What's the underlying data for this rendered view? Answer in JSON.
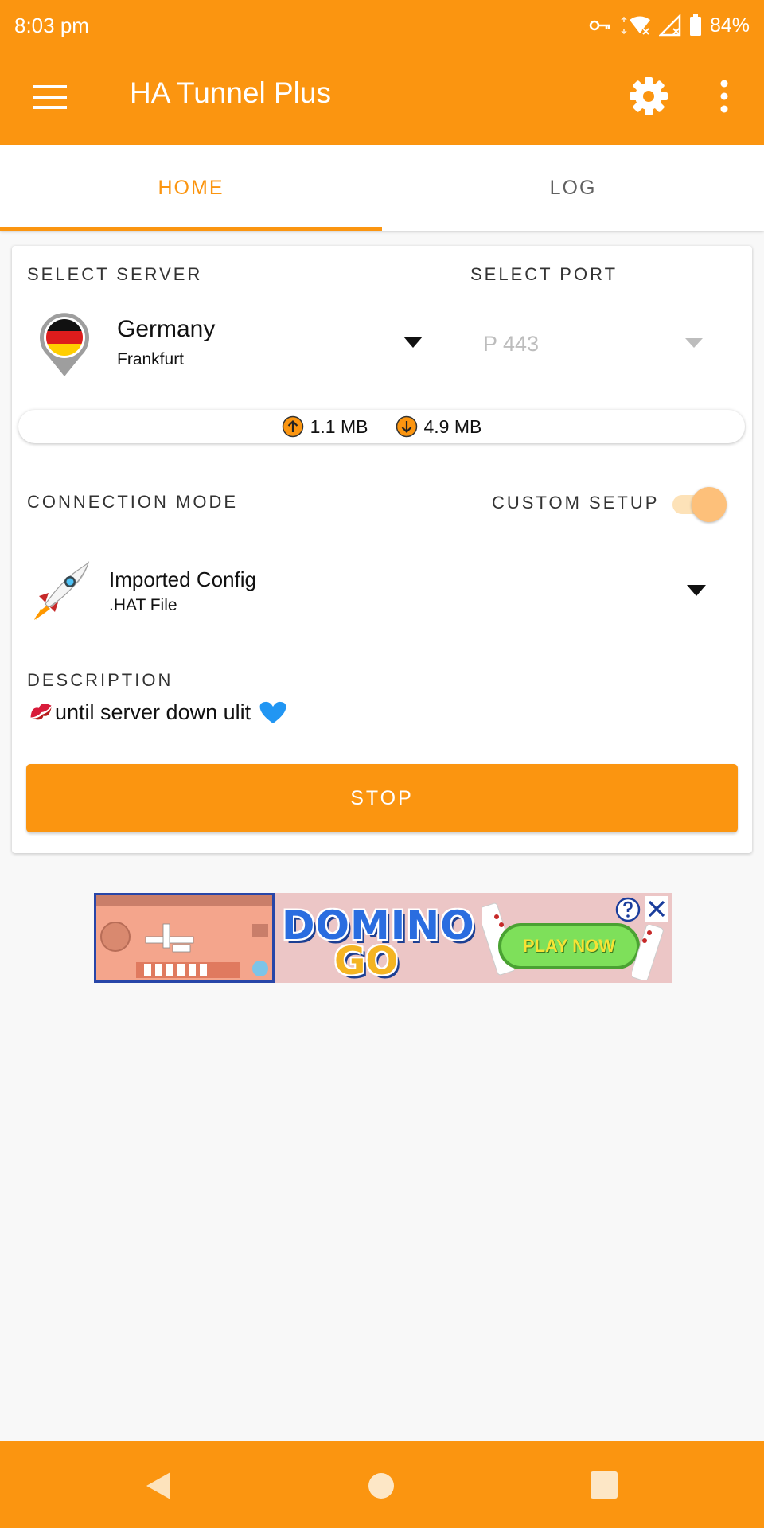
{
  "status_bar": {
    "time": "8:03 pm",
    "battery": "84%",
    "icons": [
      "vpn-key-icon",
      "wifi-icon",
      "signal-icon",
      "battery-icon"
    ]
  },
  "app_bar": {
    "title": "HA Tunnel Plus",
    "icons": [
      "hamburger-menu-icon",
      "gear-icon",
      "more-vert-icon"
    ]
  },
  "tabs": [
    {
      "label": "HOME",
      "active": true
    },
    {
      "label": "LOG",
      "active": false
    }
  ],
  "server": {
    "section_label": "SELECT SERVER",
    "name": "Germany",
    "city": "Frankfurt"
  },
  "port": {
    "section_label": "SELECT PORT",
    "value": "P 443"
  },
  "traffic": {
    "upload": "1.1 MB",
    "download": "4.9 MB"
  },
  "connection": {
    "section_label": "CONNECTION MODE",
    "custom_setup_label": "CUSTOM SETUP",
    "custom_setup_enabled": true,
    "mode_name": "Imported Config",
    "mode_file": ".HAT File"
  },
  "description": {
    "section_label": "DESCRIPTION",
    "text": "until server down ulit"
  },
  "stop_button": {
    "label": "STOP"
  },
  "ad": {
    "logo_line1": "DOMINO",
    "logo_line2": "GO",
    "cta": "PLAY NOW"
  },
  "colors": {
    "accent": "#fb9510",
    "background": "#f8f8f8",
    "card": "#ffffff",
    "port_disabled": "#bdbdbd"
  }
}
